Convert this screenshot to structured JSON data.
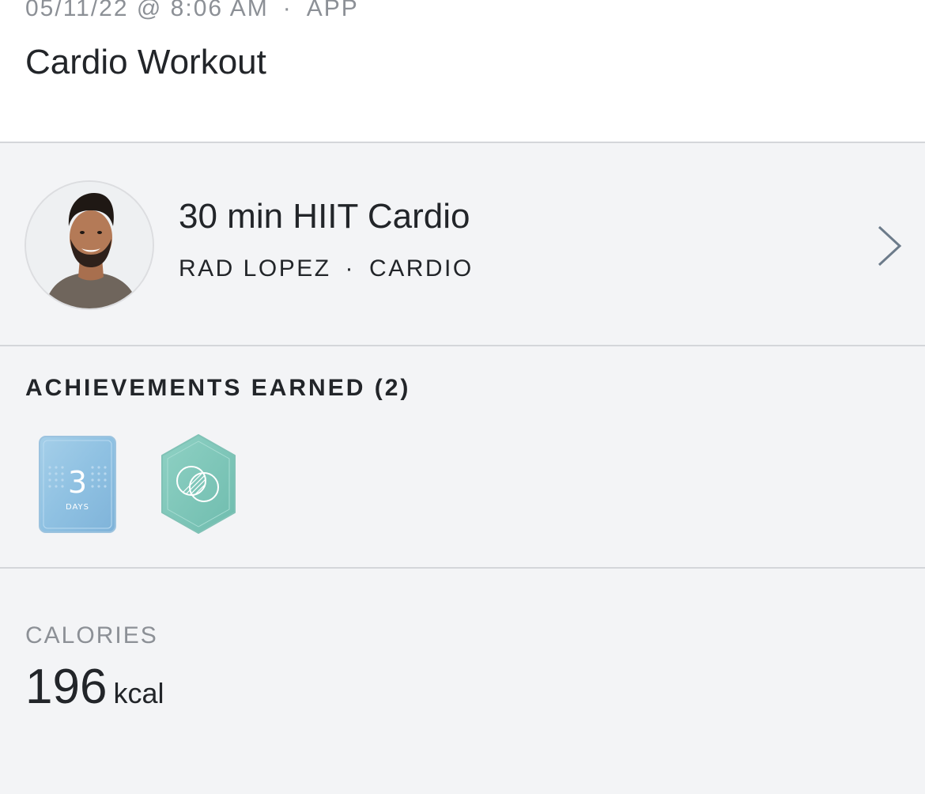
{
  "header": {
    "datetime": "05/11/22 @ 8:06 AM",
    "separator": "·",
    "source": "APP",
    "title": "Cardio Workout"
  },
  "class": {
    "title": "30 min HIIT Cardio",
    "instructor": "RAD LOPEZ",
    "separator": "·",
    "category": "CARDIO"
  },
  "achievements": {
    "heading": "ACHIEVEMENTS EARNED (2)",
    "badges": [
      {
        "icon": "streak-3-days-badge-icon",
        "number": "3",
        "label": "DAYS"
      },
      {
        "icon": "venn-circles-badge-icon"
      }
    ]
  },
  "calories": {
    "label": "CALORIES",
    "value": "196",
    "unit": "kcal"
  },
  "colors": {
    "background": "#f3f4f6",
    "text": "#222529",
    "muted": "#8c9096",
    "badge_blue": "#8ec1e3",
    "badge_teal": "#7dc7b9"
  }
}
